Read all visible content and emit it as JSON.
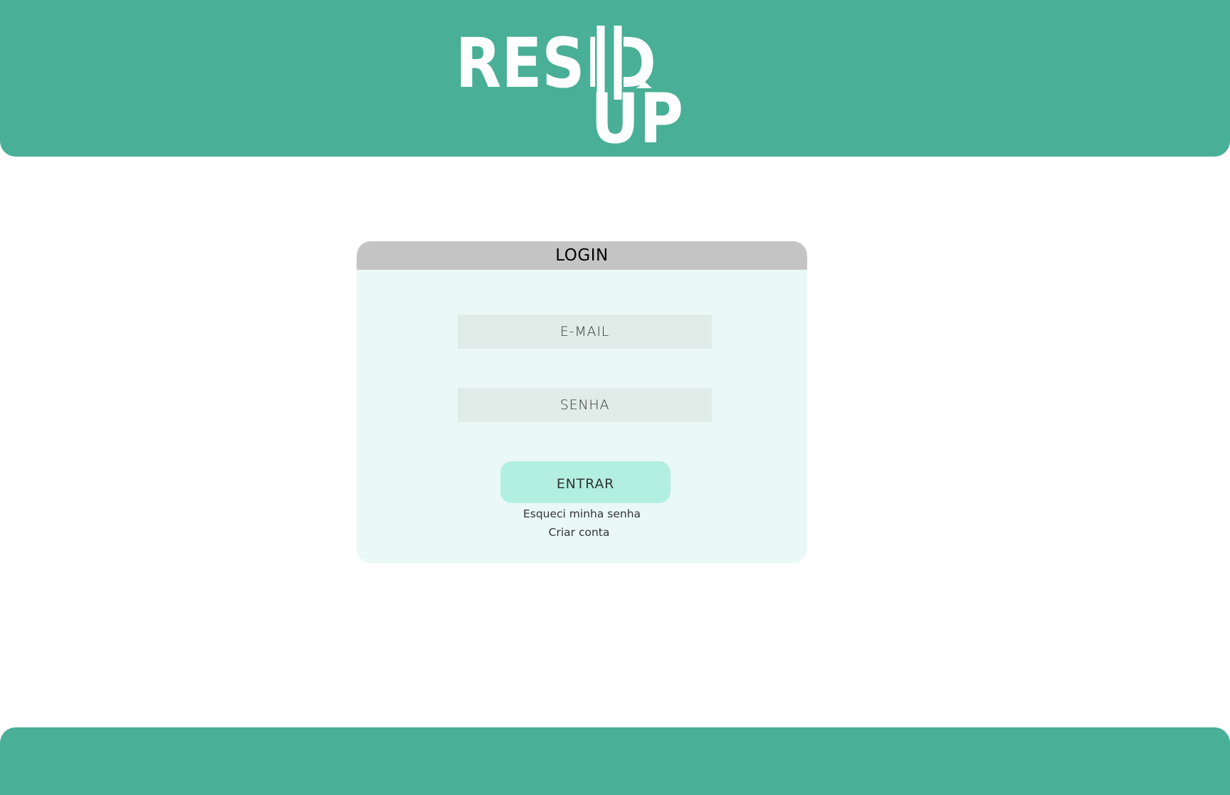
{
  "header": {
    "logo": {
      "line1": "RESID",
      "line2": "UP",
      "icon": "up-arrow-icon"
    }
  },
  "login": {
    "title": "LOGIN",
    "email_placeholder": "E-MAIL",
    "password_placeholder": "SENHA",
    "submit_label": "ENTRAR",
    "forgot_password_link": "Esqueci minha senha",
    "create_account_link": "Criar conta"
  },
  "colors": {
    "brand": "#49af96",
    "card_background": "#eaf9f5",
    "card_header": "#c4c4c4",
    "input_background": "#e0ece8",
    "button": "#b3efe0"
  }
}
